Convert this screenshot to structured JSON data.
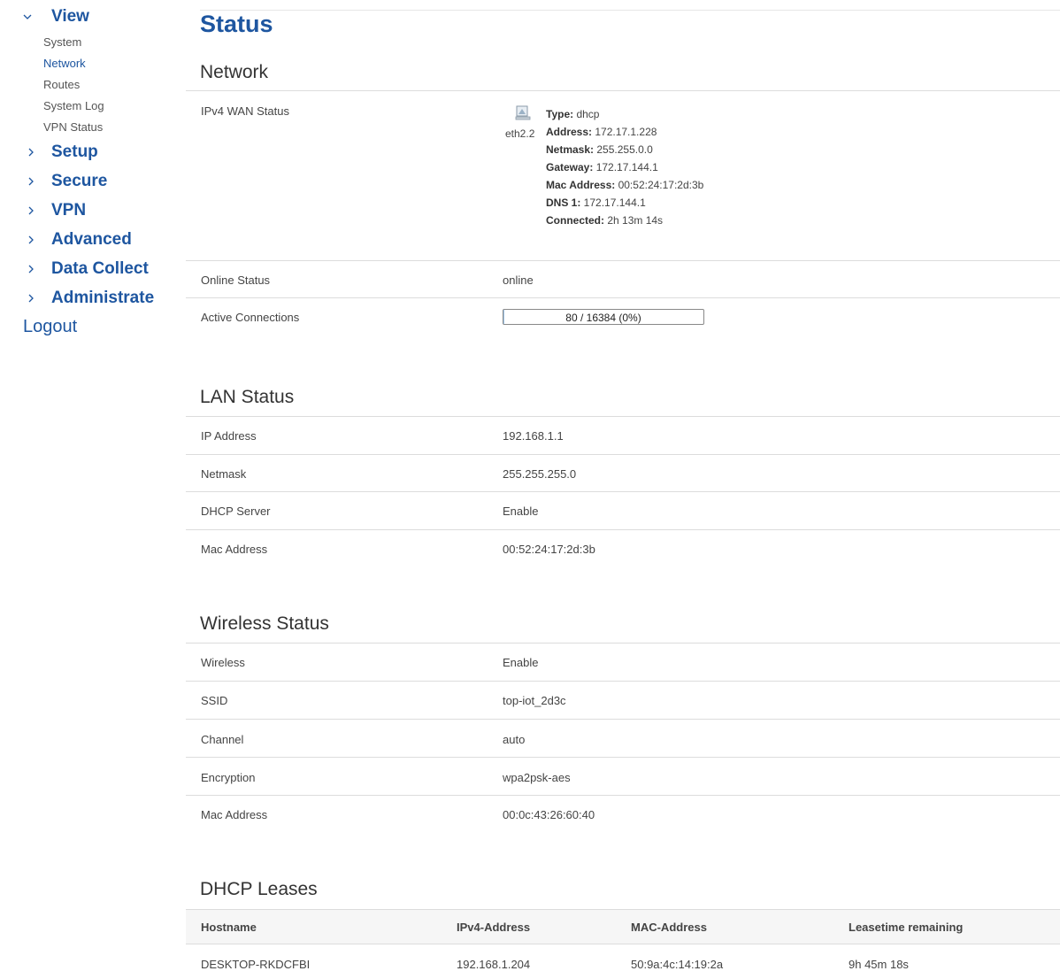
{
  "sidebar": {
    "top_label": "View",
    "sub_items": [
      {
        "label": "System",
        "active": false
      },
      {
        "label": "Network",
        "active": true
      },
      {
        "label": "Routes",
        "active": false
      },
      {
        "label": "System Log",
        "active": false
      },
      {
        "label": "VPN Status",
        "active": false
      }
    ],
    "groups": [
      "Setup",
      "Secure",
      "VPN",
      "Advanced",
      "Data Collect",
      "Administrate"
    ],
    "logout_label": "Logout"
  },
  "page_title": "Status",
  "network": {
    "title": "Network",
    "wan_label": "IPv4 WAN Status",
    "wan_icon": "network-port-icon",
    "interface": "eth2.2",
    "wan_lines": [
      {
        "key": "Type:",
        "value": " dhcp"
      },
      {
        "key": "Address:",
        "value": " 172.17.1.228"
      },
      {
        "key": "Netmask:",
        "value": " 255.255.0.0"
      },
      {
        "key": "Gateway:",
        "value": " 172.17.144.1"
      },
      {
        "key": "Mac Address:",
        "value": " 00:52:24:17:2d:3b"
      },
      {
        "key": "DNS 1:",
        "value": " 172.17.144.1"
      },
      {
        "key": "Connected:",
        "value": " 2h 13m 14s"
      }
    ],
    "online_label": "Online Status",
    "online_value": "online",
    "conn_label": "Active Connections",
    "conn_text": "80 / 16384 (0%)",
    "conn_fraction": 0.0049
  },
  "lan": {
    "title": "LAN Status",
    "rows": [
      {
        "label": "IP Address",
        "value": "192.168.1.1"
      },
      {
        "label": "Netmask",
        "value": "255.255.255.0"
      },
      {
        "label": "DHCP Server",
        "value": "Enable"
      },
      {
        "label": "Mac Address",
        "value": "00:52:24:17:2d:3b"
      }
    ]
  },
  "wireless": {
    "title": "Wireless Status",
    "rows": [
      {
        "label": "Wireless",
        "value": "Enable"
      },
      {
        "label": "SSID",
        "value": "top-iot_2d3c"
      },
      {
        "label": "Channel",
        "value": "auto"
      },
      {
        "label": "Encryption",
        "value": "wpa2psk-aes"
      },
      {
        "label": "Mac Address",
        "value": "00:0c:43:26:60:40"
      }
    ]
  },
  "dhcp": {
    "title": "DHCP Leases",
    "headers": [
      "Hostname",
      "IPv4-Address",
      "MAC-Address",
      "Leasetime remaining"
    ],
    "rows": [
      [
        "DESKTOP-RKDCFBI",
        "192.168.1.204",
        "50:9a:4c:14:19:2a",
        "9h 45m 18s"
      ]
    ]
  },
  "colors": {
    "accent": "#1e56a0",
    "divider": "#dcdcdc",
    "progress_fill": "#9ec5e8"
  }
}
